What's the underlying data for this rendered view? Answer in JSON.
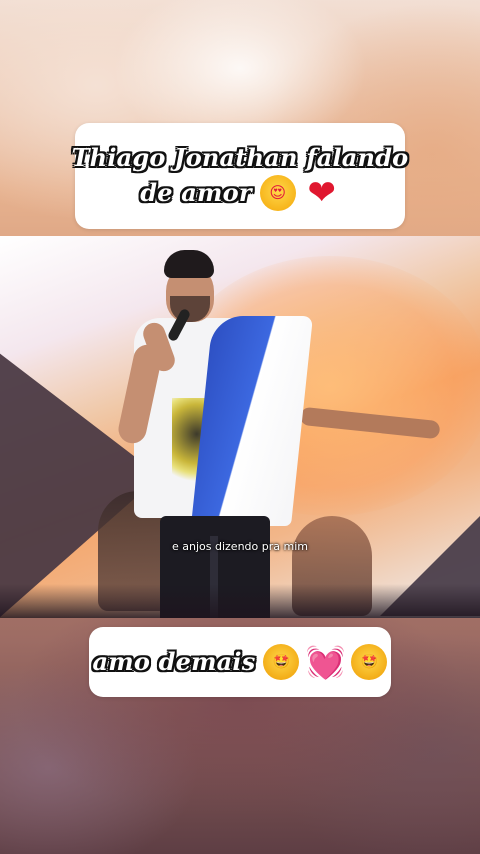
{
  "top_caption": {
    "line1": "Thiago Jonathan falando",
    "line2": "de amor",
    "emojis": [
      "heart-eyes-emoji",
      "red-heart-emoji"
    ],
    "emoji_glyphs": [
      "😍",
      "❤"
    ]
  },
  "video": {
    "subtitle": "e anjos dizendo pra mim"
  },
  "bottom_caption": {
    "text": "amo demais",
    "emojis": [
      "star-struck-emoji",
      "vibrating-heart-emoji",
      "star-struck-emoji"
    ],
    "emoji_glyphs": [
      "🤩",
      "💓",
      "🤩"
    ]
  },
  "colors": {
    "card_background": "#ffffff",
    "caption_fill": "#ffffff",
    "caption_outline": "#111111",
    "flag_blue": "#2d4fc2"
  }
}
